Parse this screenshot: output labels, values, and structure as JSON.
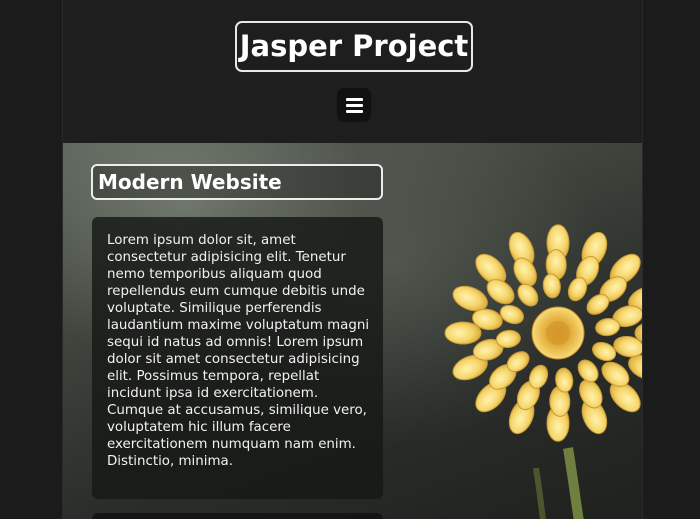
{
  "header": {
    "site_title": "Jasper Project",
    "menu_icon": "hamburger-menu-icon"
  },
  "main": {
    "section_title": "Modern Website",
    "body_text": "Lorem ipsum dolor sit, amet consectetur adipisicing elit. Tenetur nemo temporibus aliquam quod repellendus eum cumque debitis unde voluptate. Similique perferendis laudantium maxime voluptatum magni sequi id natus ad omnis! Lorem ipsum dolor sit amet consectetur adipisicing elit. Possimus tempora, repellat incidunt ipsa id exercitationem. Cumque at accusamus, similique vero, voluptatem hic illum facere exercitationem numquam nam enim. Distinctio, minima."
  },
  "colors": {
    "page_background": "#1b1b1b",
    "header_background": "#1e1e1e",
    "menu_button_background": "#111111",
    "flower_petal": "#f4d56a",
    "text": "#f2f2f2"
  }
}
